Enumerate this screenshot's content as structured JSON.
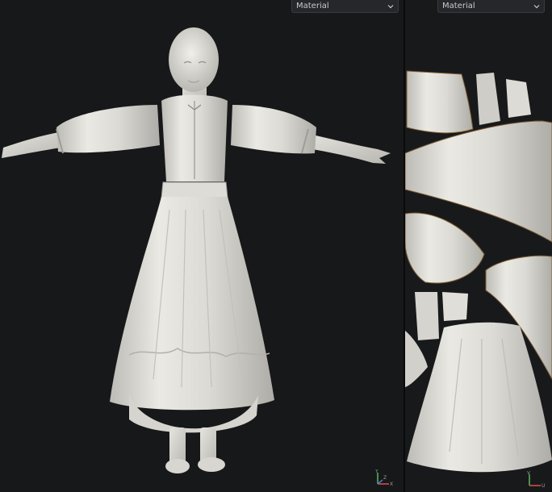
{
  "viewport_3d": {
    "shading_mode": "Material",
    "axis_x_label": "X",
    "axis_y_label": "Y",
    "axis_z_label": "Z"
  },
  "viewport_uv": {
    "shading_mode": "Material",
    "axis_u_label": "U",
    "axis_v_label": "V"
  },
  "icons": {
    "dropdown": "chevron-down-icon",
    "gizmo_3d": "axis-gizmo-icon",
    "gizmo_uv": "uv-axis-gizmo-icon"
  },
  "colors": {
    "background": "#17181a",
    "cloth": "#e4e2dc",
    "axis_x": "#d9534f",
    "axis_y": "#5cb85c",
    "axis_z": "#4a7bd0"
  }
}
